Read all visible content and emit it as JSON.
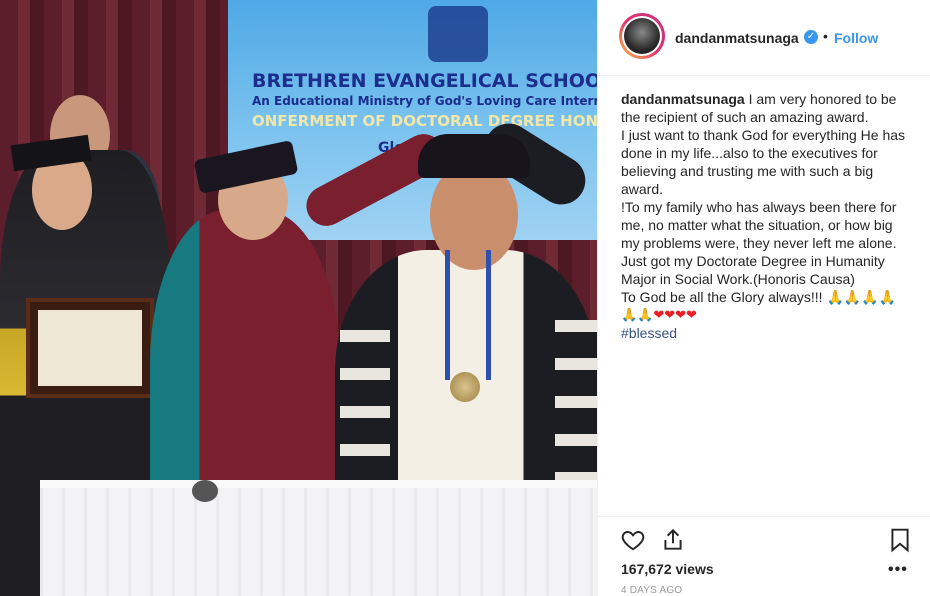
{
  "post": {
    "photo": {
      "banner_line1": "BRETHREN EVANGELICAL SCHOOL of TH",
      "banner_line2": "An Educational Ministry of God's Loving Care International",
      "banner_line3": "ONFERMENT OF DOCTORAL DEGREE HONORIS",
      "banner_line4": "Gloria H"
    }
  },
  "header": {
    "username": "dandanmatsunaga",
    "verified_icon": "verified-badge-icon",
    "separator": "•",
    "follow_label": "Follow"
  },
  "caption": {
    "username": "dandanmatsunaga",
    "line1": "I am very honored to be the recipient of such an amazing award.",
    "line2": "I just want to thank God for everything He has done in my life...also to the executives for believing and trusting me with such a big award.",
    "line3": "!To my family who has always been there for me, no matter what the situation, or how big my problems were, they never left me alone.",
    "line4": "Just got my Doctorate Degree in Humanity Major in Social Work.(Honoris Causa)",
    "line5": "To God be all the Glory always!!!",
    "hashtag": "#blessed"
  },
  "actions": {
    "like_icon": "heart-outline-icon",
    "share_icon": "share-icon",
    "save_icon": "bookmark-icon",
    "views": "167,672 views",
    "more": "•••",
    "date": "4 DAYS AGO"
  },
  "colors": {
    "link_blue": "#3897f0",
    "text": "#262626",
    "muted": "#999999",
    "hashtag": "#385185"
  }
}
